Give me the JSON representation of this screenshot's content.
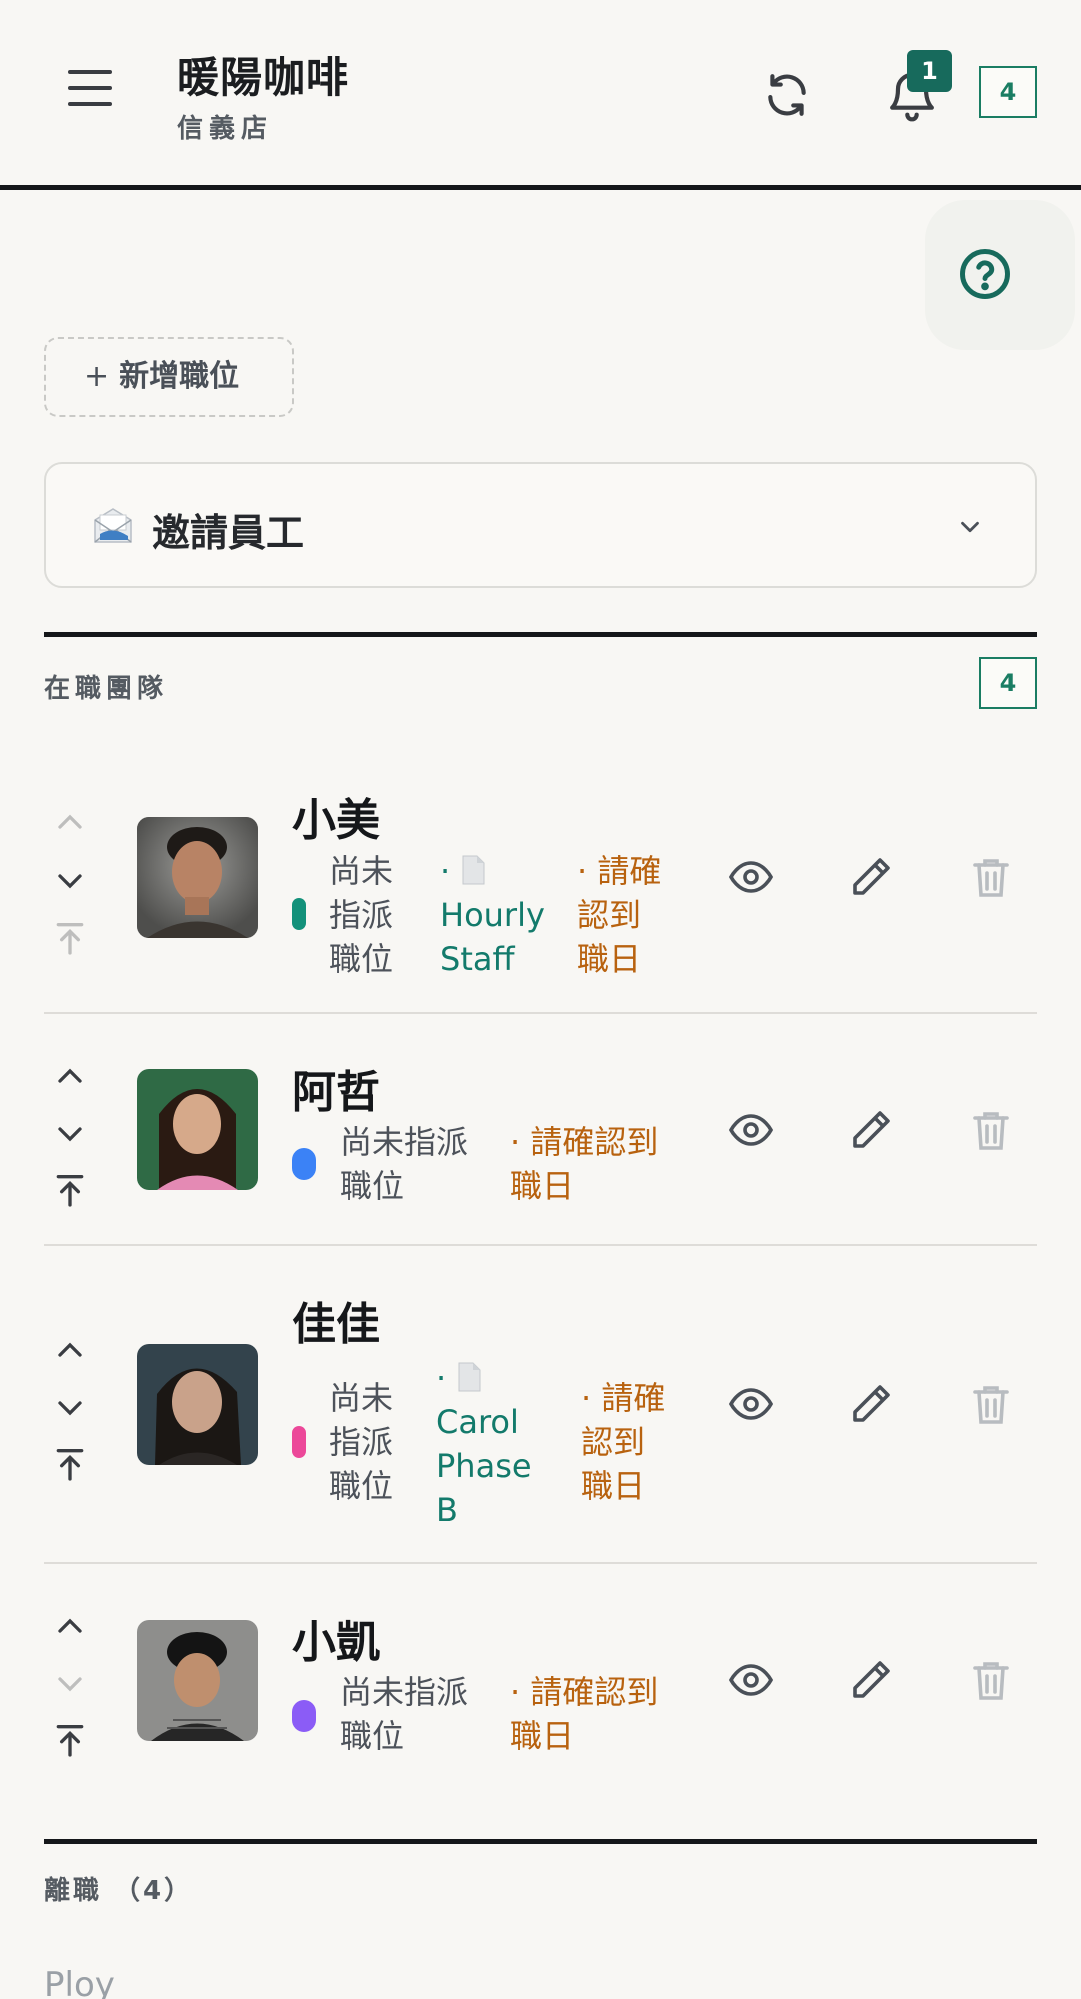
{
  "header": {
    "title": "暖陽咖啡",
    "subtitle": "信義店",
    "notification_count": "1",
    "team_count": "4"
  },
  "actions": {
    "add_role_label": "新增職位",
    "invite_label": "邀請員工"
  },
  "active_team": {
    "label": "在職團隊",
    "count": "4",
    "members": [
      {
        "name": "小美",
        "color": "#13917a",
        "position_lines": [
          "尚未",
          "指派",
          "職位"
        ],
        "template_lines": [
          "·",
          "Hourly",
          "Staff"
        ],
        "status_lines": [
          "· 請確",
          "認到",
          "職日"
        ]
      },
      {
        "name": "阿哲",
        "color": "#3b82f6",
        "position_lines": [
          "尚未指派",
          "職位"
        ],
        "status_lines": [
          "· 請確認到",
          "職日"
        ]
      },
      {
        "name": "佳佳",
        "color": "#ec4899",
        "position_lines": [
          "尚未",
          "指派",
          "職位"
        ],
        "template_lines": [
          "·",
          "Carol",
          "Phase",
          "B"
        ],
        "status_lines": [
          "· 請確",
          "認到",
          "職日"
        ]
      },
      {
        "name": "小凱",
        "color": "#8b5cf6",
        "position_lines": [
          "尚未指派",
          "職位"
        ],
        "status_lines": [
          "· 請確認到",
          "職日"
        ]
      }
    ]
  },
  "departed": {
    "label": "離職 （4）",
    "first_item_text": "Ploy"
  },
  "icons": {
    "menu": "menu-icon",
    "refresh": "refresh-icon",
    "bell": "bell-icon",
    "help": "help-icon",
    "invite": "envelope-icon",
    "chevron": "chevron-down-icon",
    "view": "eye-icon",
    "edit": "pencil-icon",
    "delete": "trash-icon",
    "move_up": "chevron-up-icon",
    "move_down": "chevron-down-icon",
    "move_top": "move-to-top-icon",
    "document": "document-icon"
  },
  "colors": {
    "accent": "#176a5c",
    "status_warning": "#b8620f",
    "template_link": "#137a6b"
  }
}
